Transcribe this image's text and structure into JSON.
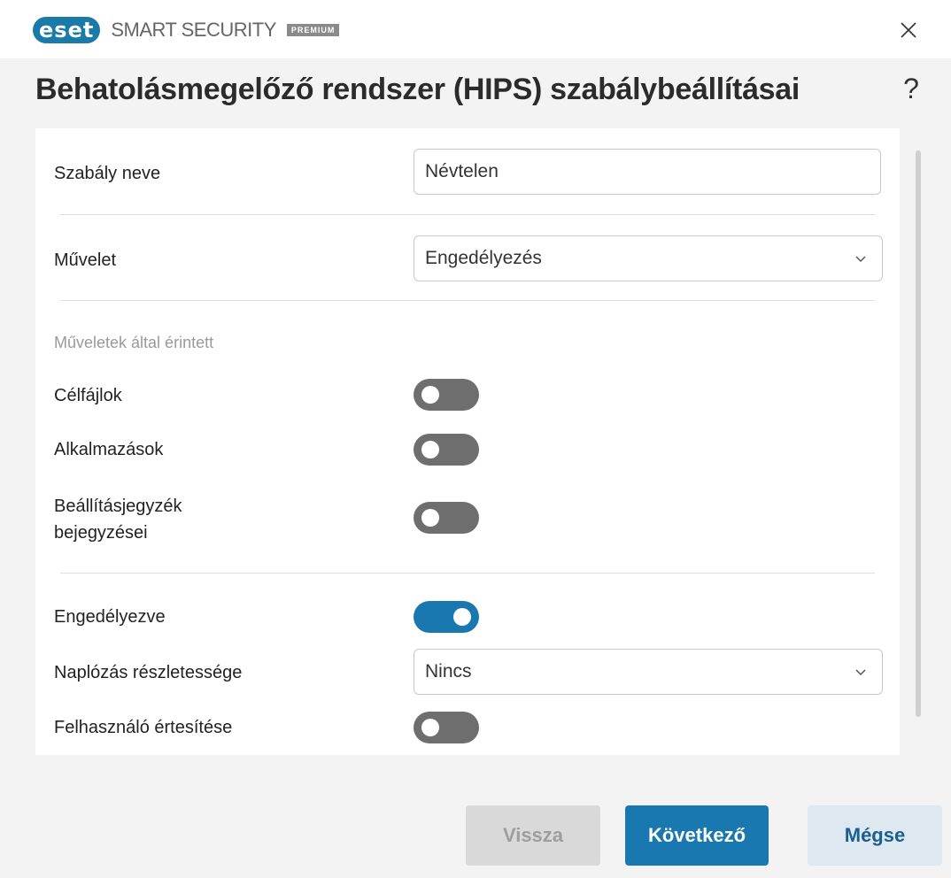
{
  "app": {
    "brand": "eset",
    "product": "SMART SECURITY",
    "edition": "PREMIUM"
  },
  "dialog": {
    "title": "Behatolásmegelőző rendszer (HIPS) szabálybeállításai",
    "help": "?"
  },
  "form": {
    "rule_name": {
      "label": "Szabály neve",
      "value": "Névtelen"
    },
    "action": {
      "label": "Művelet",
      "value": "Engedélyezés"
    },
    "affected_section": "Műveletek által érintett",
    "target_files": {
      "label": "Célfájlok",
      "on": false
    },
    "applications": {
      "label": "Alkalmazások",
      "on": false
    },
    "registry": {
      "label_line1": "Beállításjegyzék",
      "label_line2": "bejegyzései",
      "on": false
    },
    "enabled": {
      "label": "Engedélyezve",
      "on": true
    },
    "log_level": {
      "label": "Naplózás részletessége",
      "value": "Nincs"
    },
    "notify_user": {
      "label": "Felhasználó értesítése",
      "on": false
    }
  },
  "buttons": {
    "back": "Vissza",
    "next": "Következő",
    "cancel": "Mégse"
  },
  "colors": {
    "accent": "#1a78b0",
    "toggle_off": "#6e6e6e",
    "disabled_button": "#d9d9d9"
  }
}
